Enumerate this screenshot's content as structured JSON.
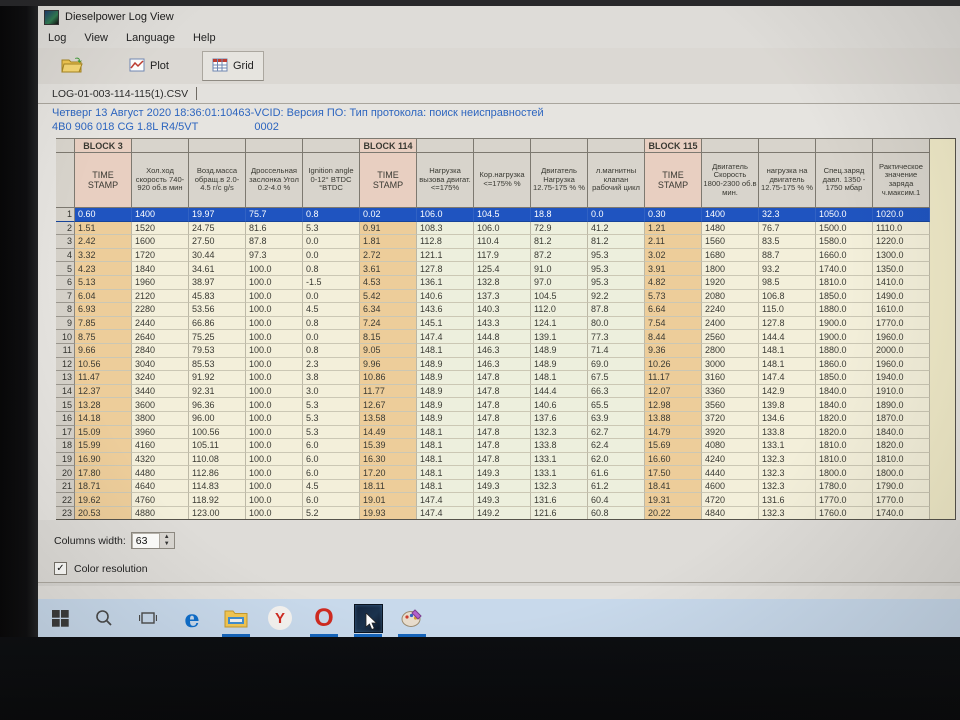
{
  "window": {
    "title": "Dieselpower Log View",
    "menu": [
      "Log",
      "View",
      "Language",
      "Help"
    ]
  },
  "toolbar": {
    "plot_label": "Plot",
    "grid_label": "Grid"
  },
  "tab": {
    "filename": "LOG-01-003-114-115(1).CSV"
  },
  "log_info": {
    "line1": "Четверг 13 Август 2020 18:36:01:10463-VCID: Версия ПО: Тип протокола: поиск неисправностей",
    "line2a": "4B0 906 018 CG  1.8L R4/5VT",
    "line2b": "0002"
  },
  "grid": {
    "selected_row": 1,
    "columns": [
      {
        "label": "TIME STAMP",
        "type": "ts",
        "block": "BLOCK 3"
      },
      {
        "label": "Хол.ход скорость 740-920 об.в мин",
        "type": "b3"
      },
      {
        "label": "Возд.масса обращ.в 2.0-4.5 г/с g/s",
        "type": "b3"
      },
      {
        "label": "Дроссельная заслонка Угол 0.2-4.0 %",
        "type": "b3"
      },
      {
        "label": "Ignition angle 0-12° BTDC °BTDC",
        "type": "b3"
      },
      {
        "label": "TIME STAMP",
        "type": "ts",
        "block": "BLOCK 114"
      },
      {
        "label": "Нагрузка вызова двигат. <=175%",
        "type": "b114"
      },
      {
        "label": "Кор.нагрузка <=175% %",
        "type": "b114"
      },
      {
        "label": "Двигатель Нагрузка 12.75-175 % %",
        "type": "b114"
      },
      {
        "label": "л.магнитны клапан рабочий цикл",
        "type": "b114"
      },
      {
        "label": "TIME STAMP",
        "type": "ts",
        "block": "BLOCK 115"
      },
      {
        "label": "Двигатель Скорость 1800-2300 об.в мин.",
        "type": "b115"
      },
      {
        "label": "нагрузка на двигатель 12.75-175 % %",
        "type": "b115"
      },
      {
        "label": "Спец.заряд давл. 1350 - 1750 мбар",
        "type": "b115"
      },
      {
        "label": "Рактическое значение заряда ч.максим.1",
        "type": "b115"
      }
    ],
    "rows": [
      {
        "n": "1",
        "cells": [
          "0.60",
          "1400",
          "19.97",
          "75.7",
          "0.8",
          "0.02",
          "106.0",
          "104.5",
          "18.8",
          "0.0",
          "0.30",
          "1400",
          "32.3",
          "1050.0",
          "1020.0"
        ]
      },
      {
        "n": "2",
        "cells": [
          "1.51",
          "1520",
          "24.75",
          "81.6",
          "5.3",
          "0.91",
          "108.3",
          "106.0",
          "72.9",
          "41.2",
          "1.21",
          "1480",
          "76.7",
          "1500.0",
          "1110.0"
        ]
      },
      {
        "n": "3",
        "cells": [
          "2.42",
          "1600",
          "27.50",
          "87.8",
          "0.0",
          "1.81",
          "112.8",
          "110.4",
          "81.2",
          "81.2",
          "2.11",
          "1560",
          "83.5",
          "1580.0",
          "1220.0"
        ]
      },
      {
        "n": "4",
        "cells": [
          "3.32",
          "1720",
          "30.44",
          "97.3",
          "0.0",
          "2.72",
          "121.1",
          "117.9",
          "87.2",
          "95.3",
          "3.02",
          "1680",
          "88.7",
          "1660.0",
          "1300.0"
        ]
      },
      {
        "n": "5",
        "cells": [
          "4.23",
          "1840",
          "34.61",
          "100.0",
          "0.8",
          "3.61",
          "127.8",
          "125.4",
          "91.0",
          "95.3",
          "3.91",
          "1800",
          "93.2",
          "1740.0",
          "1350.0"
        ]
      },
      {
        "n": "6",
        "cells": [
          "5.13",
          "1960",
          "38.97",
          "100.0",
          "-1.5",
          "4.53",
          "136.1",
          "132.8",
          "97.0",
          "95.3",
          "4.82",
          "1920",
          "98.5",
          "1810.0",
          "1410.0"
        ]
      },
      {
        "n": "7",
        "cells": [
          "6.04",
          "2120",
          "45.83",
          "100.0",
          "0.0",
          "5.42",
          "140.6",
          "137.3",
          "104.5",
          "92.2",
          "5.73",
          "2080",
          "106.8",
          "1850.0",
          "1490.0"
        ]
      },
      {
        "n": "8",
        "cells": [
          "6.93",
          "2280",
          "53.56",
          "100.0",
          "4.5",
          "6.34",
          "143.6",
          "140.3",
          "112.0",
          "87.8",
          "6.64",
          "2240",
          "115.0",
          "1880.0",
          "1610.0"
        ]
      },
      {
        "n": "9",
        "cells": [
          "7.85",
          "2440",
          "66.86",
          "100.0",
          "0.8",
          "7.24",
          "145.1",
          "143.3",
          "124.1",
          "80.0",
          "7.54",
          "2400",
          "127.8",
          "1900.0",
          "1770.0"
        ]
      },
      {
        "n": "10",
        "cells": [
          "8.75",
          "2640",
          "75.25",
          "100.0",
          "0.0",
          "8.15",
          "147.4",
          "144.8",
          "139.1",
          "77.3",
          "8.44",
          "2560",
          "144.4",
          "1900.0",
          "1960.0"
        ]
      },
      {
        "n": "11",
        "cells": [
          "9.66",
          "2840",
          "79.53",
          "100.0",
          "0.8",
          "9.05",
          "148.1",
          "146.3",
          "148.9",
          "71.4",
          "9.36",
          "2800",
          "148.1",
          "1880.0",
          "2000.0"
        ]
      },
      {
        "n": "12",
        "cells": [
          "10.56",
          "3040",
          "85.53",
          "100.0",
          "2.3",
          "9.96",
          "148.9",
          "146.3",
          "148.9",
          "69.0",
          "10.26",
          "3000",
          "148.1",
          "1860.0",
          "1960.0"
        ]
      },
      {
        "n": "13",
        "cells": [
          "11.47",
          "3240",
          "91.92",
          "100.0",
          "3.8",
          "10.86",
          "148.9",
          "147.8",
          "148.1",
          "67.5",
          "11.17",
          "3160",
          "147.4",
          "1850.0",
          "1940.0"
        ]
      },
      {
        "n": "14",
        "cells": [
          "12.37",
          "3440",
          "92.31",
          "100.0",
          "3.0",
          "11.77",
          "148.9",
          "147.8",
          "144.4",
          "66.3",
          "12.07",
          "3360",
          "142.9",
          "1840.0",
          "1910.0"
        ]
      },
      {
        "n": "15",
        "cells": [
          "13.28",
          "3600",
          "96.36",
          "100.0",
          "5.3",
          "12.67",
          "148.9",
          "147.8",
          "140.6",
          "65.5",
          "12.98",
          "3560",
          "139.8",
          "1840.0",
          "1890.0"
        ]
      },
      {
        "n": "16",
        "cells": [
          "14.18",
          "3800",
          "96.00",
          "100.0",
          "5.3",
          "13.58",
          "148.9",
          "147.8",
          "137.6",
          "63.9",
          "13.88",
          "3720",
          "134.6",
          "1820.0",
          "1870.0"
        ]
      },
      {
        "n": "17",
        "cells": [
          "15.09",
          "3960",
          "100.56",
          "100.0",
          "5.3",
          "14.49",
          "148.1",
          "147.8",
          "132.3",
          "62.7",
          "14.79",
          "3920",
          "133.8",
          "1820.0",
          "1840.0"
        ]
      },
      {
        "n": "18",
        "cells": [
          "15.99",
          "4160",
          "105.11",
          "100.0",
          "6.0",
          "15.39",
          "148.1",
          "147.8",
          "133.8",
          "62.4",
          "15.69",
          "4080",
          "133.1",
          "1810.0",
          "1820.0"
        ]
      },
      {
        "n": "19",
        "cells": [
          "16.90",
          "4320",
          "110.08",
          "100.0",
          "6.0",
          "16.30",
          "148.1",
          "147.8",
          "133.1",
          "62.0",
          "16.60",
          "4240",
          "132.3",
          "1810.0",
          "1810.0"
        ]
      },
      {
        "n": "20",
        "cells": [
          "17.80",
          "4480",
          "112.86",
          "100.0",
          "6.0",
          "17.20",
          "148.1",
          "149.3",
          "133.1",
          "61.6",
          "17.50",
          "4440",
          "132.3",
          "1800.0",
          "1800.0"
        ]
      },
      {
        "n": "21",
        "cells": [
          "18.71",
          "4640",
          "114.83",
          "100.0",
          "4.5",
          "18.11",
          "148.1",
          "149.3",
          "132.3",
          "61.2",
          "18.41",
          "4600",
          "132.3",
          "1780.0",
          "1790.0"
        ]
      },
      {
        "n": "22",
        "cells": [
          "19.62",
          "4760",
          "118.92",
          "100.0",
          "6.0",
          "19.01",
          "147.4",
          "149.3",
          "131.6",
          "60.4",
          "19.31",
          "4720",
          "131.6",
          "1770.0",
          "1770.0"
        ]
      },
      {
        "n": "23",
        "cells": [
          "20.53",
          "4880",
          "123.00",
          "100.0",
          "5.2",
          "19.93",
          "147.4",
          "149.2",
          "121.6",
          "60.8",
          "20.22",
          "4840",
          "132.3",
          "1760.0",
          "1740.0"
        ]
      }
    ]
  },
  "controls": {
    "columns_width_label": "Columns width:",
    "columns_width_value": "63",
    "color_resolution_label": "Color resolution",
    "color_resolution_checked": "✓"
  },
  "taskbar": {
    "edge_glyph": "e",
    "yandex_glyph": "Y",
    "opera_glyph": "O"
  },
  "colors": {
    "selected_row": "#1c54c6",
    "timestamp_column": "#efcd97",
    "block3_column": "#f3efd9",
    "block114_column": "#edefdc",
    "info_text": "#2a65c4",
    "taskbar": "#c7d9ec"
  }
}
